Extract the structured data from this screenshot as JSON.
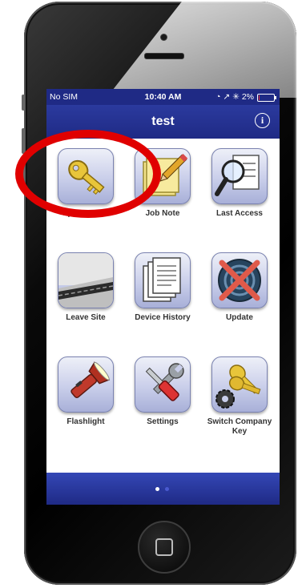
{
  "status_bar": {
    "carrier": "No SIM  ",
    "time": "10:40 AM",
    "indicators": "◔ ↗ ✳ 2%",
    "battery_percent": 2
  },
  "nav": {
    "title": "test",
    "info_label": "i"
  },
  "tiles": [
    {
      "label": "Open Device",
      "icon": "key-icon"
    },
    {
      "label": "Job Note",
      "icon": "notepad-pencil-icon"
    },
    {
      "label": "Last Access",
      "icon": "magnifier-document-icon"
    },
    {
      "label": "Leave Site",
      "icon": "road-icon"
    },
    {
      "label": "Device History",
      "icon": "documents-stack-icon"
    },
    {
      "label": "Update",
      "icon": "target-cross-icon"
    },
    {
      "label": "Flashlight",
      "icon": "flashlight-icon"
    },
    {
      "label": "Settings",
      "icon": "wrench-screwdriver-icon"
    },
    {
      "label": "Switch Company Key",
      "icon": "keys-gear-icon"
    }
  ],
  "pager": {
    "pages": 2,
    "current": 1
  },
  "colors": {
    "bar": "#1f2a85",
    "highlight": "#e00000"
  }
}
